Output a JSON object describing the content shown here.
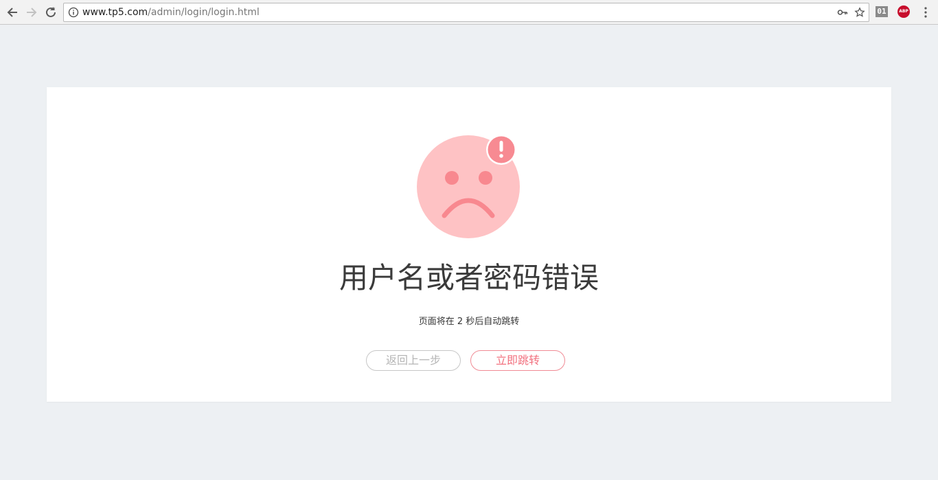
{
  "browser": {
    "url_host": "www.tp5.com",
    "url_path": "/admin/login/login.html",
    "ext_01_label": "01",
    "ext_abp_label": "ABP"
  },
  "message": {
    "title": "用户名或者密码错误",
    "subtitle": "页面将在 2 秒后自动跳转",
    "back_label": "返回上一步",
    "jump_label": "立即跳转"
  },
  "colors": {
    "background": "#edf0f3",
    "face": "#fec2c4",
    "accent": "#f28a93"
  },
  "icons": [
    "back-arrow-icon",
    "forward-arrow-icon",
    "reload-icon",
    "info-icon",
    "key-icon",
    "star-icon",
    "menu-icon",
    "sad-face-icon",
    "exclamation-badge-icon"
  ]
}
